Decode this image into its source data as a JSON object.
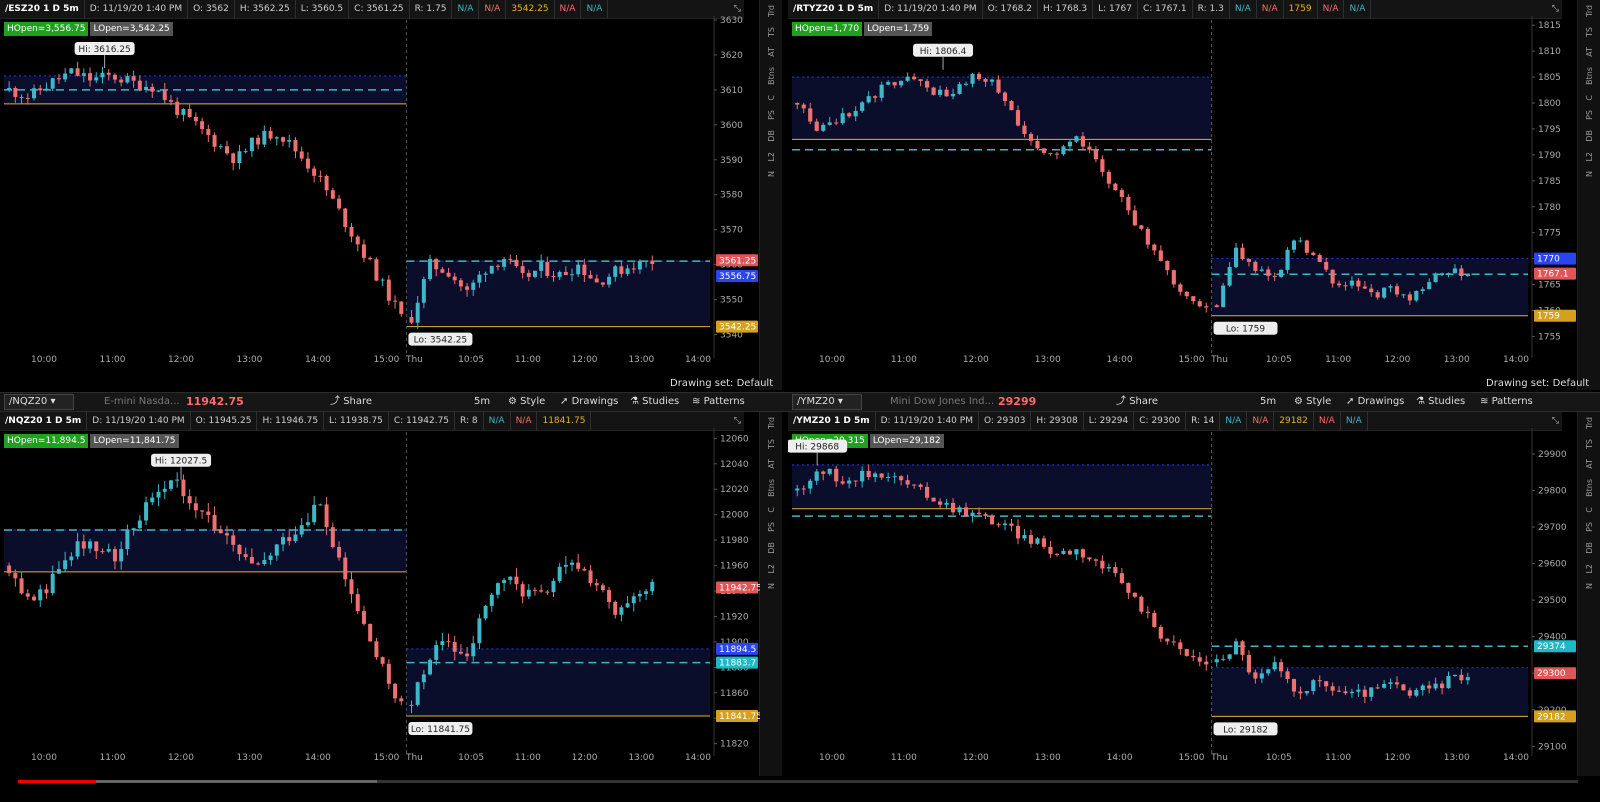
{
  "colors": {
    "up": "#3fb7c8",
    "down": "#f07070",
    "high_level": "#1e3cff",
    "low_level": "#e6b326",
    "bg": "#000000"
  },
  "toolbars": [
    {
      "symbol": "/NQZ20",
      "description": "E-mini Nasda...",
      "price": "11942.75",
      "buttons": [
        "Share",
        "5m",
        "Style",
        "Drawings",
        "Studies",
        "Patterns"
      ]
    },
    {
      "symbol": "/YMZ20",
      "description": "Mini Dow Jones Ind...",
      "price": "29299",
      "buttons": [
        "Share",
        "5m",
        "Style",
        "Drawings",
        "Studies",
        "Patterns"
      ]
    }
  ],
  "drawing_set": "Drawing set: Default",
  "side_tabs": [
    "Trd",
    "TS",
    "AT",
    "Btns",
    "C",
    "PS",
    "DB",
    "L2",
    "N"
  ],
  "video_progress": 0.05,
  "chart_data": [
    {
      "type": "candlestick",
      "symbol_label": "/ESZ20 1 D 5m",
      "header": [
        "D: 11/19/20 1:40 PM",
        "O: 3562",
        "H: 3562.25",
        "L: 3560.5",
        "C: 3561.25",
        "R: 1.75"
      ],
      "extra_header": [
        "N/A",
        "N/A",
        "3542.25",
        "N/A",
        "N/A"
      ],
      "badges": [
        "HOpen=3,556.75",
        "LOpen=3,542.25"
      ],
      "ylim": [
        3535,
        3630
      ],
      "yticks": [
        3540,
        3550,
        3560,
        3570,
        3580,
        3590,
        3600,
        3610,
        3620,
        3630
      ],
      "xticks": [
        "10:00",
        "11:00",
        "12:00",
        "13:00",
        "14:00",
        "15:00",
        "Thu",
        "10:05",
        "11:00",
        "12:00",
        "13:00",
        "14:00"
      ],
      "hi_label": "Hi: 3616.25",
      "hi_value": 3616.25,
      "lo_label": "Lo: 3542.25",
      "lo_value": 3542.25,
      "price_tags": [
        {
          "text": "3561.25",
          "value": 3561.25,
          "color": "#e05555"
        },
        {
          "text": "3556.75",
          "value": 3556.75,
          "color": "#2a44ee"
        },
        {
          "text": "3542.25",
          "value": 3542.25,
          "color": "#d4a020"
        }
      ],
      "day1_path": [
        3610,
        3608,
        3612,
        3615,
        3613,
        3614,
        3612,
        3611,
        3605,
        3600,
        3595,
        3590,
        3596,
        3598,
        3592,
        3585,
        3575,
        3565,
        3555,
        3545
      ],
      "day2_path": [
        3545,
        3560,
        3558,
        3552,
        3559,
        3562,
        3556,
        3559,
        3557,
        3560,
        3555,
        3558,
        3560,
        3561
      ],
      "prev_day_high": 3614,
      "prev_day_mid": 3610,
      "prev_day_low": 3606,
      "day2_range_high": 3561,
      "day2_mid": 3561,
      "day2_range_low": 3542.25
    },
    {
      "type": "candlestick",
      "symbol_label": "/RTYZ20 1 D 5m",
      "header": [
        "D: 11/19/20 1:40 PM",
        "O: 1768.2",
        "H: 1768.3",
        "L: 1767",
        "C: 1767.1",
        "R: 1.3"
      ],
      "extra_header": [
        "N/A",
        "N/A",
        "1759",
        "N/A",
        "N/A"
      ],
      "badges": [
        "HOpen=1,770",
        "LOpen=1,759"
      ],
      "ylim": [
        1752,
        1816
      ],
      "yticks": [
        1755,
        1760,
        1765,
        1770,
        1775,
        1780,
        1785,
        1790,
        1795,
        1800,
        1805,
        1810,
        1815
      ],
      "xticks": [
        "10:00",
        "11:00",
        "12:00",
        "13:00",
        "14:00",
        "15:00",
        "Thu",
        "10:05",
        "11:00",
        "12:00",
        "13:00",
        "14:00"
      ],
      "hi_label": "Hi: 1806.4",
      "hi_value": 1806.4,
      "lo_label": "Lo: 1759",
      "lo_value": 1759,
      "price_tags": [
        {
          "text": "1770",
          "value": 1770,
          "color": "#2a44ee"
        },
        {
          "text": "1767.1",
          "value": 1767.1,
          "color": "#e05555"
        },
        {
          "text": "1759",
          "value": 1759,
          "color": "#d4a020"
        }
      ],
      "day1_path": [
        1800,
        1795,
        1797,
        1800,
        1803,
        1805,
        1803,
        1801,
        1805,
        1804,
        1798,
        1792,
        1790,
        1793,
        1788,
        1782,
        1775,
        1768,
        1763,
        1761
      ],
      "day2_path": [
        1761,
        1772,
        1768,
        1766,
        1774,
        1770,
        1766,
        1765,
        1763,
        1764,
        1762,
        1765,
        1768,
        1767
      ],
      "prev_day_high": 1805,
      "prev_day_mid": 1791,
      "prev_day_low": 1793,
      "day2_range_high": 1770,
      "day2_mid": 1767,
      "day2_range_low": 1759
    },
    {
      "type": "candlestick",
      "symbol_label": "/NQZ20 1 D 5m",
      "header": [
        "D: 11/19/20 1:40 PM",
        "O: 11945.25",
        "H: 11946.75",
        "L: 11938.75",
        "C: 11942.75",
        "R: 8"
      ],
      "extra_header": [
        "N/A",
        "N/A",
        "11841.75"
      ],
      "badges": [
        "HOpen=11,894.5",
        "LOpen=11,841.75"
      ],
      "ylim": [
        11815,
        12065
      ],
      "yticks": [
        11820,
        11840,
        11860,
        11880,
        11900,
        11920,
        11940,
        11960,
        11980,
        12000,
        12020,
        12040,
        12060
      ],
      "xticks": [
        "10:00",
        "11:00",
        "12:00",
        "13:00",
        "14:00",
        "15:00",
        "Thu",
        "10:05",
        "11:00",
        "12:00",
        "13:00",
        "14:00"
      ],
      "hi_label": "Hi: 12027.5",
      "hi_value": 12027.5,
      "lo_label": "Lo: 11841.75",
      "lo_value": 11841.75,
      "price_tags": [
        {
          "text": "11942.75",
          "value": 11942.75,
          "color": "#e05555"
        },
        {
          "text": "11894.5",
          "value": 11894.5,
          "color": "#2a44ee"
        },
        {
          "text": "11883.7",
          "value": 11883.7,
          "color": "#20b8c8"
        },
        {
          "text": "11841.75",
          "value": 11841.75,
          "color": "#d4a020"
        }
      ],
      "day1_path": [
        11960,
        11930,
        11945,
        11970,
        11980,
        11965,
        11990,
        12020,
        12027,
        12010,
        11990,
        11970,
        11955,
        11975,
        11990,
        12010,
        11960,
        11920,
        11880,
        11850
      ],
      "day2_path": [
        11850,
        11890,
        11900,
        11885,
        11930,
        11950,
        11940,
        11935,
        11955,
        11960,
        11945,
        11920,
        11930,
        11943
      ],
      "prev_day_high": 11988,
      "prev_day_mid": 11988,
      "prev_day_low": 11955,
      "day2_range_high": 11894.5,
      "day2_mid": 11883.7,
      "day2_range_low": 11841.75
    },
    {
      "type": "candlestick",
      "symbol_label": "/YMZ20 1 D 5m",
      "header": [
        "D: 11/19/20 1:40 PM",
        "O: 29303",
        "H: 29308",
        "L: 29294",
        "C: 29300",
        "R: 14"
      ],
      "extra_header": [
        "N/A",
        "N/A",
        "29182",
        "N/A",
        "N/A"
      ],
      "badges": [
        "HOpen=29,315",
        "LOpen=29,182"
      ],
      "ylim": [
        29090,
        29960
      ],
      "yticks": [
        29100,
        29200,
        29300,
        29400,
        29500,
        29600,
        29700,
        29800,
        29900
      ],
      "xticks": [
        "10:00",
        "11:00",
        "12:00",
        "13:00",
        "14:00",
        "15:00",
        "Thu",
        "10:05",
        "11:00",
        "12:00",
        "13:00",
        "14:00"
      ],
      "hi_label": "Hi: 29868",
      "hi_value": 29868,
      "lo_label": "Lo: 29182",
      "lo_value": 29182,
      "price_tags": [
        {
          "text": "29374",
          "value": 29374,
          "color": "#20b8c8"
        },
        {
          "text": "29300",
          "value": 29300,
          "color": "#e05555"
        },
        {
          "text": "29182",
          "value": 29182,
          "color": "#d4a020"
        }
      ],
      "day1_path": [
        29800,
        29860,
        29830,
        29840,
        29850,
        29820,
        29790,
        29760,
        29740,
        29720,
        29690,
        29660,
        29630,
        29640,
        29600,
        29550,
        29480,
        29400,
        29350,
        29330
      ],
      "day2_path": [
        29330,
        29380,
        29280,
        29320,
        29250,
        29270,
        29260,
        29240,
        29250,
        29270,
        29240,
        29260,
        29280,
        29300
      ],
      "prev_day_high": 29870,
      "prev_day_mid": 29730,
      "prev_day_low": 29750,
      "day2_range_high": 29315,
      "day2_mid": 29374,
      "day2_range_low": 29182
    }
  ]
}
